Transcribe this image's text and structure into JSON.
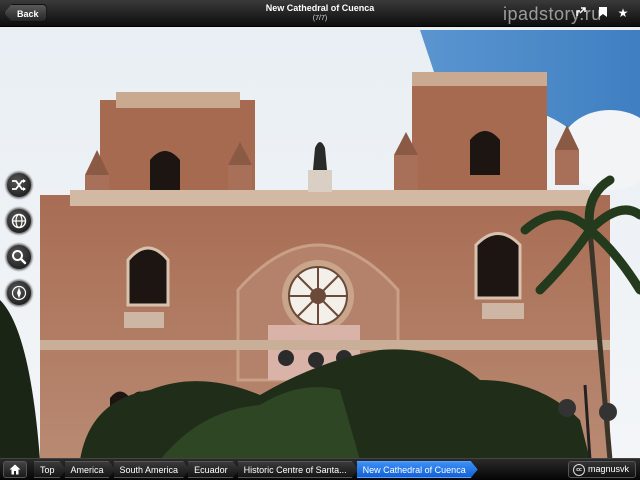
{
  "topbar": {
    "back_label": "Back",
    "title": "New Cathedral of Cuenca",
    "subtitle": "(7/7)",
    "watermark": "ipadstory.ru"
  },
  "topbar_icons": [
    "share-icon",
    "bookmark-icon",
    "star-icon"
  ],
  "side_buttons": [
    "shuffle-icon",
    "globe-icon",
    "search-icon",
    "compass-icon"
  ],
  "breadcrumbs": {
    "items": [
      "Top",
      "America",
      "South America",
      "Ecuador",
      "Historic Centre of Santa...",
      "New Cathedral of Cuenca"
    ]
  },
  "credit": {
    "cc_label": "cc",
    "author": "magnusvk"
  },
  "colors": {
    "sky": "#a9cdea",
    "brick": "#b07a5f",
    "crumb_active": "#1e6ee0"
  }
}
